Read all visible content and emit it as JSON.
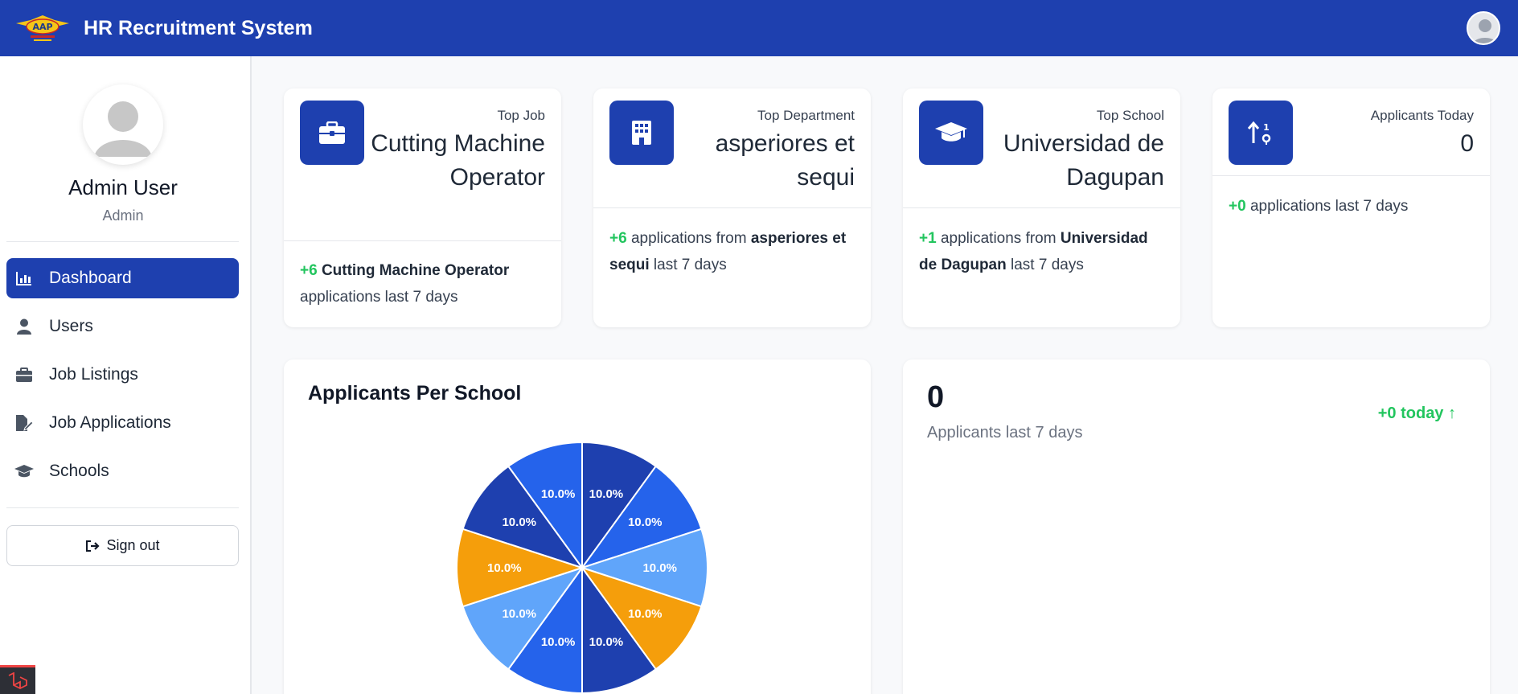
{
  "header": {
    "title": "HR Recruitment System"
  },
  "sidebar": {
    "user_name": "Admin User",
    "user_role": "Admin",
    "nav": [
      {
        "label": "Dashboard",
        "icon": "chart-bar-icon",
        "active": true
      },
      {
        "label": "Users",
        "icon": "user-icon",
        "active": false
      },
      {
        "label": "Job Listings",
        "icon": "briefcase-icon",
        "active": false
      },
      {
        "label": "Job Applications",
        "icon": "file-edit-icon",
        "active": false
      },
      {
        "label": "Schools",
        "icon": "graduation-cap-icon",
        "active": false
      }
    ],
    "signout_label": "Sign out"
  },
  "stats": {
    "top_job": {
      "label": "Top Job",
      "value": "Cutting Machine Operator",
      "delta": "+6",
      "foot_name": "Cutting Machine Operator",
      "foot_text": "applications last 7 days",
      "icon": "briefcase-icon"
    },
    "top_department": {
      "label": "Top Department",
      "value": "asperiores et sequi",
      "delta": "+6",
      "foot_pre": "applications from",
      "foot_name": "asperiores et sequi",
      "foot_post": "last 7 days",
      "icon": "building-icon"
    },
    "top_school": {
      "label": "Top School",
      "value": "Universidad de Dagupan",
      "delta": "+1",
      "foot_pre": "applications from",
      "foot_name": "Universidad de Dagupan",
      "foot_post": "last 7 days",
      "icon": "graduation-cap-icon"
    },
    "applicants_today": {
      "label": "Applicants Today",
      "value": "0",
      "delta": "+0",
      "foot_text": "applications last 7 days",
      "icon": "sort-arrows-icon"
    }
  },
  "pie_card": {
    "title": "Applicants Per School"
  },
  "chart_data": {
    "type": "pie",
    "title": "Applicants Per School",
    "slices": [
      {
        "value": 10.0,
        "label": "10.0%",
        "color": "#1e40af"
      },
      {
        "value": 10.0,
        "label": "10.0%",
        "color": "#2563eb"
      },
      {
        "value": 10.0,
        "label": "10.0%",
        "color": "#60a5fa"
      },
      {
        "value": 10.0,
        "label": "10.0%",
        "color": "#f59e0b"
      },
      {
        "value": 10.0,
        "label": "10.0%",
        "color": "#1e40af"
      },
      {
        "value": 10.0,
        "label": "10.0%",
        "color": "#2563eb"
      },
      {
        "value": 10.0,
        "label": "10.0%",
        "color": "#60a5fa"
      },
      {
        "value": 10.0,
        "label": "10.0%",
        "color": "#f59e0b"
      },
      {
        "value": 10.0,
        "label": "10.0%",
        "color": "#1e40af"
      },
      {
        "value": 10.0,
        "label": "10.0%",
        "color": "#2563eb"
      }
    ]
  },
  "weekly": {
    "count": "0",
    "caption": "Applicants last 7 days",
    "today_delta": "+0 today ↑"
  },
  "colors": {
    "primary": "#1e40af",
    "positive": "#22c55e"
  }
}
